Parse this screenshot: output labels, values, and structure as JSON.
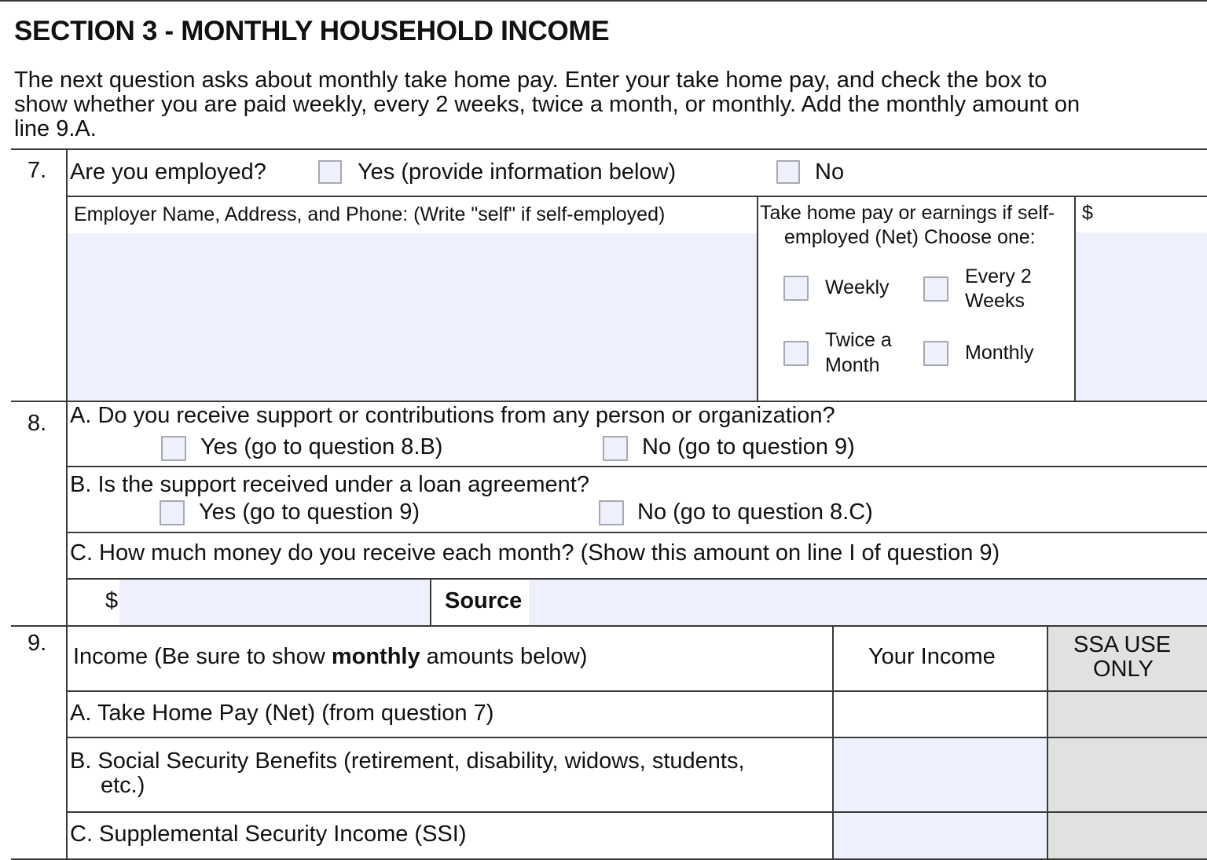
{
  "section": {
    "title": "SECTION 3 - MONTHLY HOUSEHOLD INCOME",
    "intro_lines": [
      "The next question asks about monthly take home pay.  Enter your take home pay, and check the box  to",
      "show whether you are paid weekly, every 2 weeks, twice a month, or monthly. Add the monthly amount on",
      "line 9.A."
    ]
  },
  "q7": {
    "number": "7.",
    "question": "Are you employed?",
    "yes_label": "Yes (provide information below)",
    "no_label": "No",
    "employer_label": "Employer Name, Address, and Phone: (Write \"self\" if self-employed)",
    "employer_value": "",
    "pay_label_line1": "Take home pay or earnings if self-",
    "pay_label_line2": "employed (Net) Choose one:",
    "frequency_options": [
      {
        "line1": "Weekly",
        "line2": ""
      },
      {
        "line1": "Every 2",
        "line2": "Weeks"
      },
      {
        "line1": "Twice a",
        "line2": "Month"
      },
      {
        "line1": "Monthly",
        "line2": ""
      }
    ],
    "currency_symbol": "$",
    "amount_value": ""
  },
  "q8": {
    "number": "8.",
    "a": {
      "question": "A. Do you receive support or contributions from any person or organization?",
      "yes_label": "Yes (go to question 8.B)",
      "no_label": "No (go to question 9)"
    },
    "b": {
      "question": "B. Is the support received under a loan agreement?",
      "yes_label": "Yes (go to question 9)",
      "no_label": "No (go to question 8.C)"
    },
    "c": {
      "question": "C. How much money do you receive each month? (Show this amount on line I of question 9)",
      "currency_symbol": "$",
      "amount_value": "",
      "source_label": "Source",
      "source_value": ""
    }
  },
  "q9": {
    "number": "9.",
    "header_prefix": "Income (Be sure to show ",
    "header_bold": "monthly",
    "header_suffix": " amounts below)",
    "col_your_income": "Your Income",
    "col_ssa_line1": "SSA USE",
    "col_ssa_line2": "ONLY",
    "rows": [
      {
        "label_line1": "A. Take Home Pay (Net) (from question 7)",
        "label_line2": "",
        "value": ""
      },
      {
        "label_line1": "B. Social Security Benefits (retirement, disability, widows, students,",
        "label_line2": "etc.)",
        "value": ""
      },
      {
        "label_line1": "C. Supplemental Security Income (SSI)",
        "label_line2": "",
        "value": ""
      }
    ]
  }
}
